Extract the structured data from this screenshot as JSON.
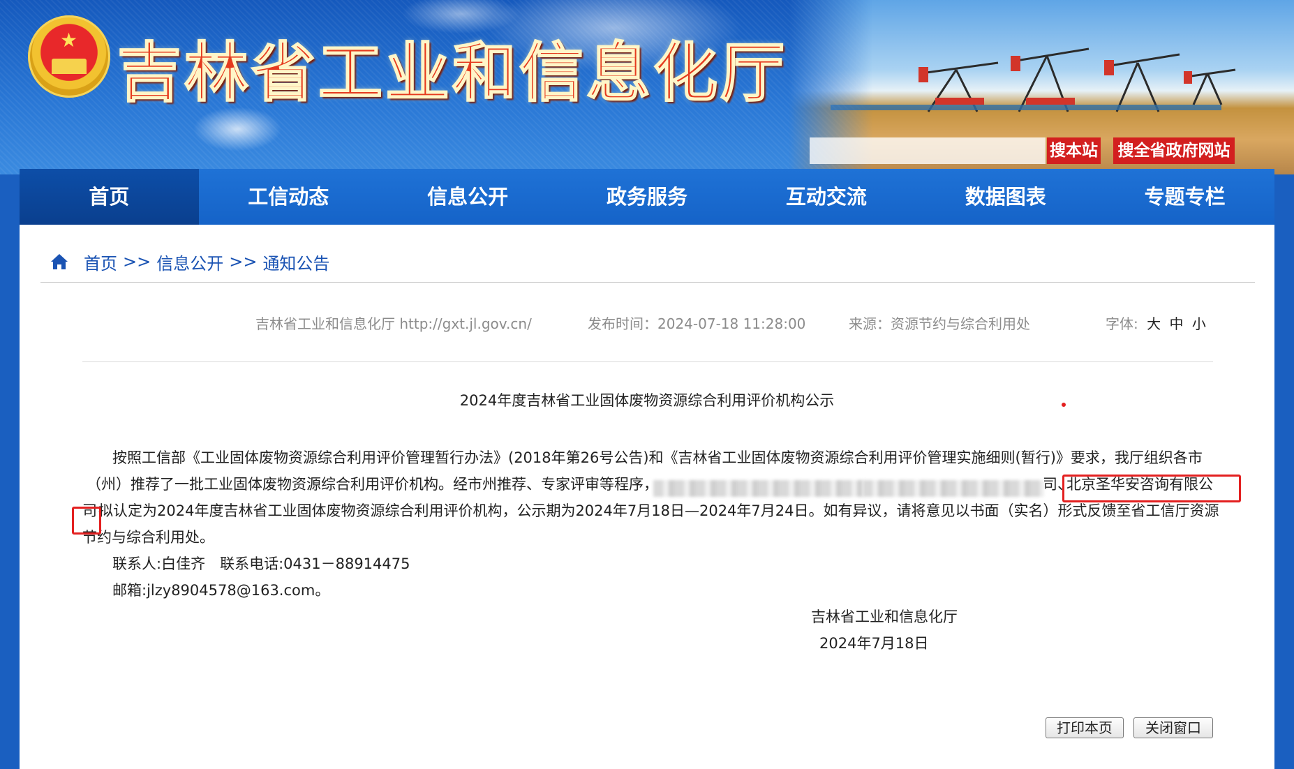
{
  "header": {
    "site_title": "吉林省工业和信息化厅",
    "search_placeholder": "",
    "search_site_label": "搜本站",
    "search_gov_label": "搜全省政府网站"
  },
  "nav": {
    "items": [
      {
        "label": "首页",
        "active": true
      },
      {
        "label": "工信动态",
        "active": false
      },
      {
        "label": "信息公开",
        "active": false
      },
      {
        "label": "政务服务",
        "active": false
      },
      {
        "label": "互动交流",
        "active": false
      },
      {
        "label": "数据图表",
        "active": false
      },
      {
        "label": "专题专栏",
        "active": false
      }
    ]
  },
  "breadcrumb": {
    "items": [
      "首页",
      "信息公开",
      "通知公告"
    ],
    "separator": ">>"
  },
  "meta": {
    "site": "吉林省工业和信息化厅 http://gxt.jl.gov.cn/",
    "publish_time": "发布时间：2024-07-18 11:28:00",
    "source": "来源：资源节约与综合利用处",
    "font_label": "字体:",
    "font_sizes": [
      "大",
      "中",
      "小"
    ]
  },
  "article": {
    "title": "2024年度吉林省工业固体废物资源综合利用评价机构公示",
    "line1": "按照工信部《工业固体废物资源综合利用评价管理暂行办法》(2018年第26号公告)和《吉林省工业固体废物资源综合利用评价管理实施细则(暂行)》要求，我厅组织各市",
    "line2_start": "（州）推荐了一批工业固体废物资源综合利用评价机构。经市州推荐、专家评审等程序，",
    "line2_tail": "司、",
    "line2_highlight": "北京圣华安咨询有限公",
    "line3_highlight": "司",
    "line3_rest": "拟认定为2024年度吉林省工业固体废物资源综合利用评价机构，公示期为2024年7月18日—2024年7月24日。如有异议，请将意见以书面（实名）形式反馈至省工信厅资源",
    "line4": "节约与综合利用处。",
    "contact": "联系人:白佳齐　联系电话:0431－88914475",
    "email": "邮箱:jlzy8904578@163.com。",
    "signature_org": "吉林省工业和信息化厅",
    "signature_date": "2024年7月18日"
  },
  "actions": {
    "print_label": "打印本页",
    "close_label": "关闭窗口"
  },
  "colors": {
    "nav_bg": "#1563c8",
    "nav_active_bg": "#0a3f8e",
    "search_btn_bg": "#d31f1f",
    "highlight_border": "#e32020",
    "link": "#1a53b3"
  }
}
